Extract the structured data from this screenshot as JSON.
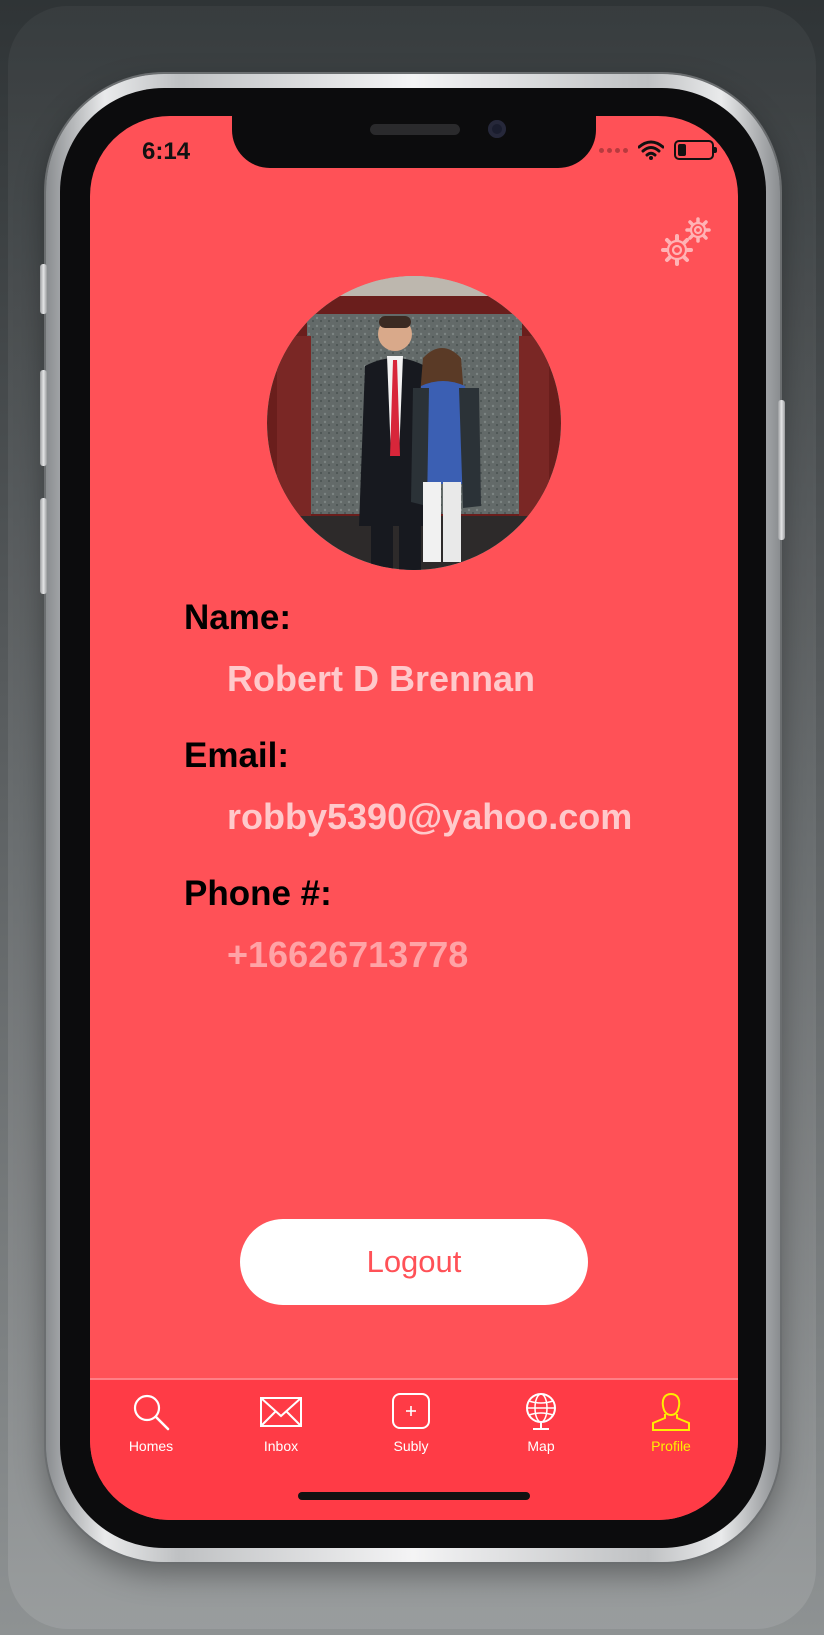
{
  "status_bar": {
    "time": "6:14"
  },
  "profile": {
    "name_label": "Name:",
    "name_value": "Robert D Brennan",
    "email_label": "Email:",
    "email_value": "robby5390@yahoo.com",
    "phone_label": "Phone #:",
    "phone_value": "+16626713778"
  },
  "logout_label": "Logout",
  "tabs": [
    {
      "label": "Homes",
      "icon": "search-icon"
    },
    {
      "label": "Inbox",
      "icon": "envelope-icon"
    },
    {
      "label": "Subly",
      "icon": "plus-square-icon"
    },
    {
      "label": "Map",
      "icon": "globe-icon"
    },
    {
      "label": "Profile",
      "icon": "person-icon",
      "active": true
    }
  ],
  "colors": {
    "screen_bg": "#ff5157",
    "tabbar_bg": "#ff3b46",
    "active_tab": "#ffee00",
    "value_text": "#ffc9cb"
  }
}
